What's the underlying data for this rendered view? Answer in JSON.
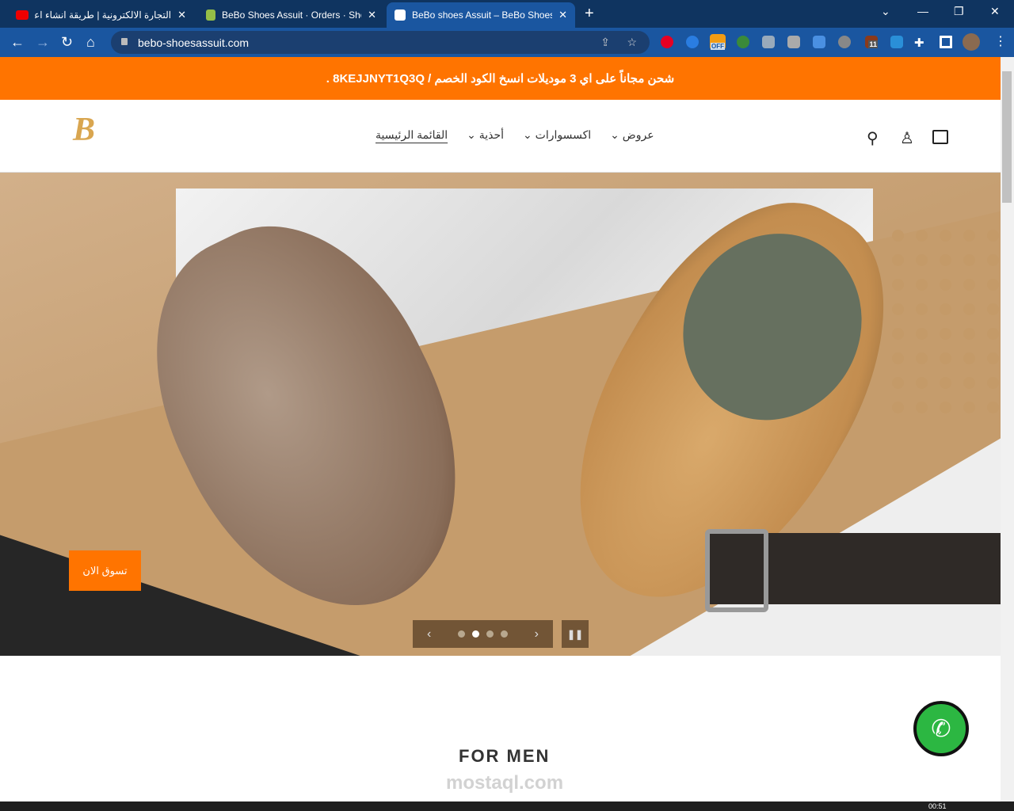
{
  "browser": {
    "tabs": [
      {
        "title": "التجارة الالكترونية | طريقة انشاء اعلان",
        "icon": "youtube-icon"
      },
      {
        "title": "BeBo Shoes Assuit · Orders · Shopify",
        "icon": "shopify-icon"
      },
      {
        "title": "BeBo shoes Assuit – BeBo Shoes",
        "icon": "bebo-icon",
        "active": true
      }
    ],
    "url": "bebo-shoesassuit.com",
    "extension_badges": {
      "off": "OFF",
      "count": "11"
    }
  },
  "promo": {
    "text": "شحن مجاناً على اي 3 موديلات انسخ الكود الخصم / 8KEJJNYT1Q3Q ."
  },
  "header": {
    "logo": "B",
    "nav": [
      {
        "label": "القائمة الرئيسية"
      },
      {
        "label": "أحذية",
        "chev": "⌄"
      },
      {
        "label": "اكسسوارات",
        "chev": "⌄"
      },
      {
        "label": "عروض",
        "chev": "⌄"
      }
    ]
  },
  "hero": {
    "cta": "تسوق الان",
    "slides": 4,
    "active_slide": 2
  },
  "section": {
    "title": "FOR MEN"
  },
  "watermark": "mostaql.com",
  "taskbar": {
    "time": "00:51"
  },
  "colors": {
    "accent": "#ff7400",
    "chrome": "#1a56a0"
  }
}
